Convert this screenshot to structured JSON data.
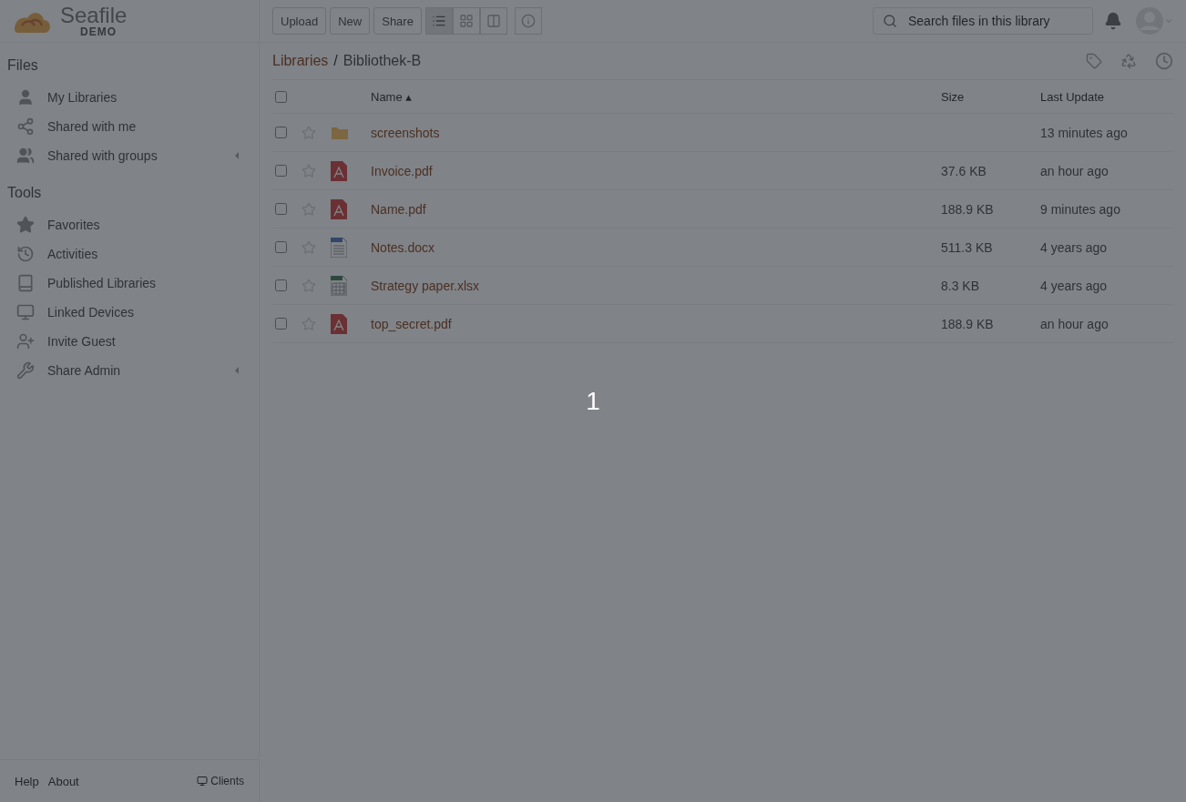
{
  "logo": {
    "name": "Seafile",
    "sub": "DEMO"
  },
  "toolbar": {
    "buttons": [
      "Upload",
      "New",
      "Share"
    ],
    "view_modes": [
      {
        "kind": "list",
        "selected": true
      },
      {
        "kind": "grid",
        "selected": false
      },
      {
        "kind": "columns",
        "selected": false
      }
    ]
  },
  "search": {
    "placeholder": "Search files in this library"
  },
  "sidebar": {
    "sections": [
      {
        "title": "Files",
        "items": [
          {
            "label": "My Libraries",
            "kind": "user",
            "expandable": false
          },
          {
            "label": "Shared with me",
            "kind": "share",
            "expandable": false
          },
          {
            "label": "Shared with groups",
            "kind": "group",
            "expandable": true
          }
        ]
      },
      {
        "title": "Tools",
        "items": [
          {
            "label": "Favorites",
            "kind": "star",
            "expandable": false
          },
          {
            "label": "Activities",
            "kind": "history",
            "expandable": false
          },
          {
            "label": "Published Libraries",
            "kind": "book",
            "expandable": false
          },
          {
            "label": "Linked Devices",
            "kind": "monitor",
            "expandable": false
          },
          {
            "label": "Invite Guest",
            "kind": "invite",
            "expandable": false
          },
          {
            "label": "Share Admin",
            "kind": "wrench",
            "expandable": true
          }
        ]
      }
    ]
  },
  "footer": {
    "links": [
      "Help",
      "About"
    ],
    "clients": "Clients"
  },
  "breadcrumb": {
    "root": "Libraries",
    "separator": "/",
    "current": "Bibliothek-B"
  },
  "table": {
    "columns": {
      "name": "Name",
      "sort_mark": "▴",
      "size": "Size",
      "updated": "Last Update"
    },
    "all_checked": false,
    "rows": [
      {
        "name": "screenshots",
        "kind": "folder",
        "size": "",
        "updated": "13 minutes ago",
        "checked": false,
        "starred": false
      },
      {
        "name": "Invoice.pdf",
        "kind": "pdf",
        "size": "37.6 KB",
        "updated": "an hour ago",
        "checked": false,
        "starred": false
      },
      {
        "name": "Name.pdf",
        "kind": "pdf",
        "size": "188.9 KB",
        "updated": "9 minutes ago",
        "checked": false,
        "starred": false
      },
      {
        "name": "Notes.docx",
        "kind": "doc",
        "size": "511.3 KB",
        "updated": "4 years ago",
        "checked": false,
        "starred": false
      },
      {
        "name": "Strategy paper.xlsx",
        "kind": "sheet",
        "size": "8.3 KB",
        "updated": "4 years ago",
        "checked": false,
        "starred": false
      },
      {
        "name": "top_secret.pdf",
        "kind": "pdf",
        "size": "188.9 KB",
        "updated": "an hour ago",
        "checked": false,
        "starred": false
      }
    ]
  },
  "overlay": {
    "counter": "1"
  }
}
